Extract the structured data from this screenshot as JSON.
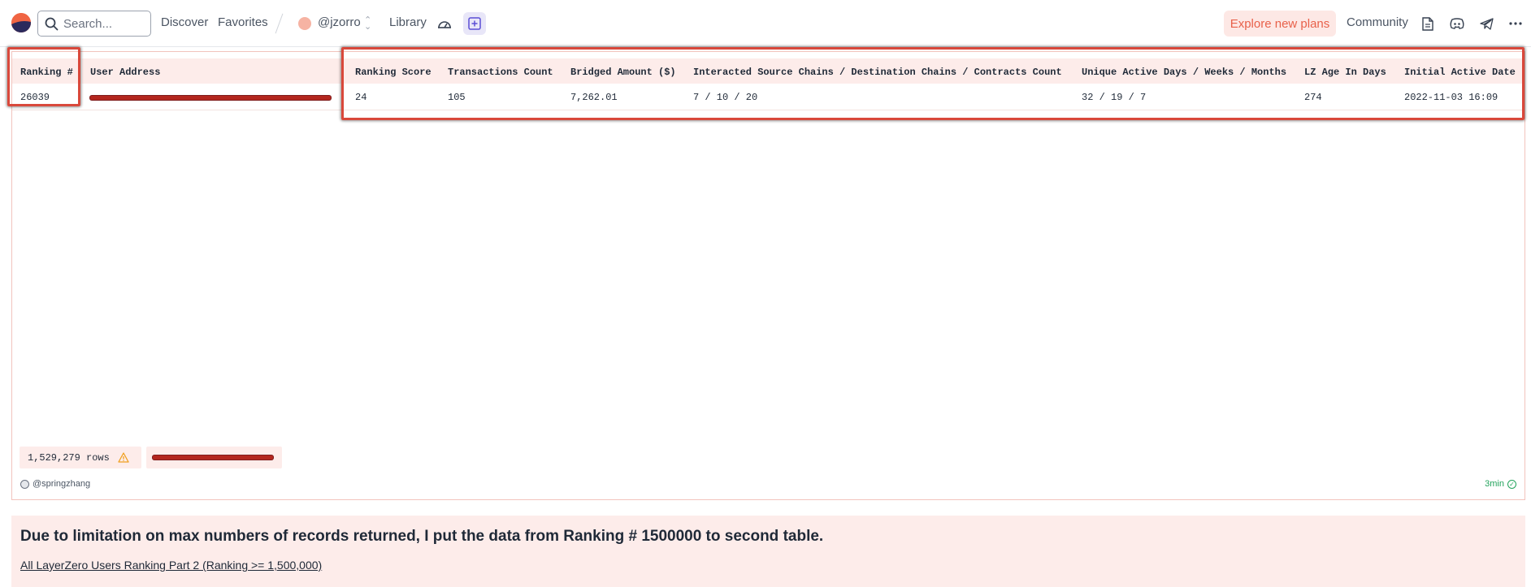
{
  "nav": {
    "search_placeholder": "Search...",
    "discover": "Discover",
    "favorites": "Favorites",
    "team": "@jzorro",
    "library": "Library",
    "explore_plans": "Explore new plans",
    "community": "Community",
    "icons": [
      "logo-icon",
      "search-icon",
      "chevron-updown-icon",
      "dashboard-gauge-icon",
      "plus-square-icon",
      "docs-icon",
      "discord-icon",
      "telegram-icon",
      "more-icon"
    ]
  },
  "table": {
    "columns": [
      "Ranking #",
      "User Address",
      "Ranking Score",
      "Transactions Count",
      "Bridged Amount ($)",
      "Interacted Source Chains / Destination Chains / Contracts Count",
      "Unique Active Days / Weeks / Months",
      "LZ Age In Days",
      "Initial Active Date"
    ],
    "rows": [
      {
        "ranking": "26039",
        "address": "[redacted]",
        "score": "24",
        "tx_count": "105",
        "bridged": "7,262.01",
        "chains_contracts": "7 / 10 / 20",
        "active": "32 / 19 / 7",
        "lz_age": "274",
        "initial_date": "2022-11-03 16:09"
      }
    ],
    "row_count": "1,529,279 rows",
    "author": "@springzhang",
    "duration": "3min",
    "highlight_color": "#d9483b",
    "header_bg": "#fdecea"
  },
  "text_widget": {
    "heading": "Due to limitation on max numbers of records returned, I put the data from Ranking # 1500000 to second table.",
    "link": "All LayerZero Users Ranking Part 2 (Ranking >= 1,500,000)"
  },
  "colors": {
    "accent": "#e8614a",
    "accent_bg": "#fde8e5",
    "plus_bg": "#e8e6f8",
    "success": "#22a35b"
  }
}
